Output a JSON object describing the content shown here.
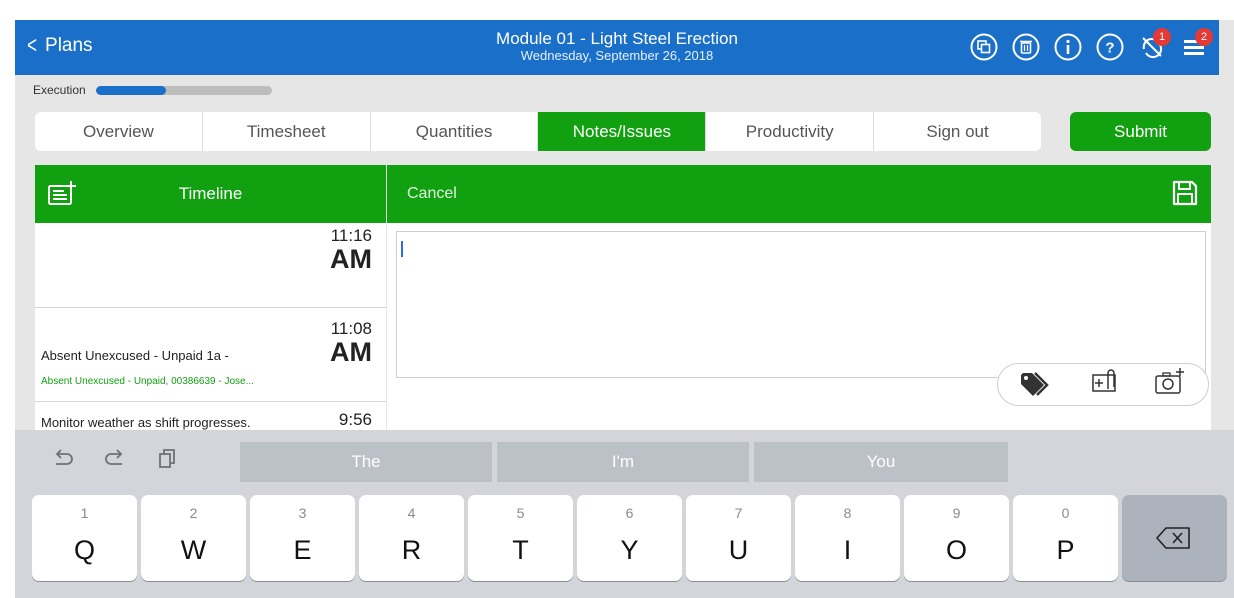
{
  "header": {
    "back_label": "Plans",
    "title": "Module 01 - Light Steel Erection",
    "subtitle": "Wednesday, September 26, 2018",
    "icons": [
      "copy-icon",
      "trash-icon",
      "info-icon",
      "help-icon",
      "sync-off-icon",
      "menu-icon"
    ],
    "badges": {
      "sync": "1",
      "menu": "2"
    }
  },
  "execution": {
    "label": "Execution",
    "progress": 0.4
  },
  "tabs": [
    {
      "label": "Overview"
    },
    {
      "label": "Timesheet"
    },
    {
      "label": "Quantities"
    },
    {
      "label": "Notes/Issues",
      "active": true
    },
    {
      "label": "Productivity"
    },
    {
      "label": "Sign out"
    }
  ],
  "submit_label": "Submit",
  "timeline": {
    "title": "Timeline",
    "items": [
      {
        "text": "",
        "sub": "",
        "time": "11:16",
        "ampm": "AM"
      },
      {
        "text": "Absent Unexcused - Unpaid 1a -",
        "sub": "Absent Unexcused - Unpaid, 00386639 - Jose...",
        "time": "11:08",
        "ampm": "AM"
      },
      {
        "text": "Monitor weather as shift progresses.",
        "sub": "",
        "time": "9:56",
        "ampm": ""
      }
    ]
  },
  "editor": {
    "cancel_label": "Cancel",
    "text": ""
  },
  "keyboard": {
    "suggestions": [
      "The",
      "I'm",
      "You"
    ],
    "row": [
      {
        "num": "1",
        "letter": "Q"
      },
      {
        "num": "2",
        "letter": "W"
      },
      {
        "num": "3",
        "letter": "E"
      },
      {
        "num": "4",
        "letter": "R"
      },
      {
        "num": "5",
        "letter": "T"
      },
      {
        "num": "6",
        "letter": "Y"
      },
      {
        "num": "7",
        "letter": "U"
      },
      {
        "num": "8",
        "letter": "I"
      },
      {
        "num": "9",
        "letter": "O"
      },
      {
        "num": "0",
        "letter": "P"
      }
    ]
  },
  "colors": {
    "blue": "#1a6fc9",
    "green": "#11a110",
    "badge": "#e53935"
  }
}
